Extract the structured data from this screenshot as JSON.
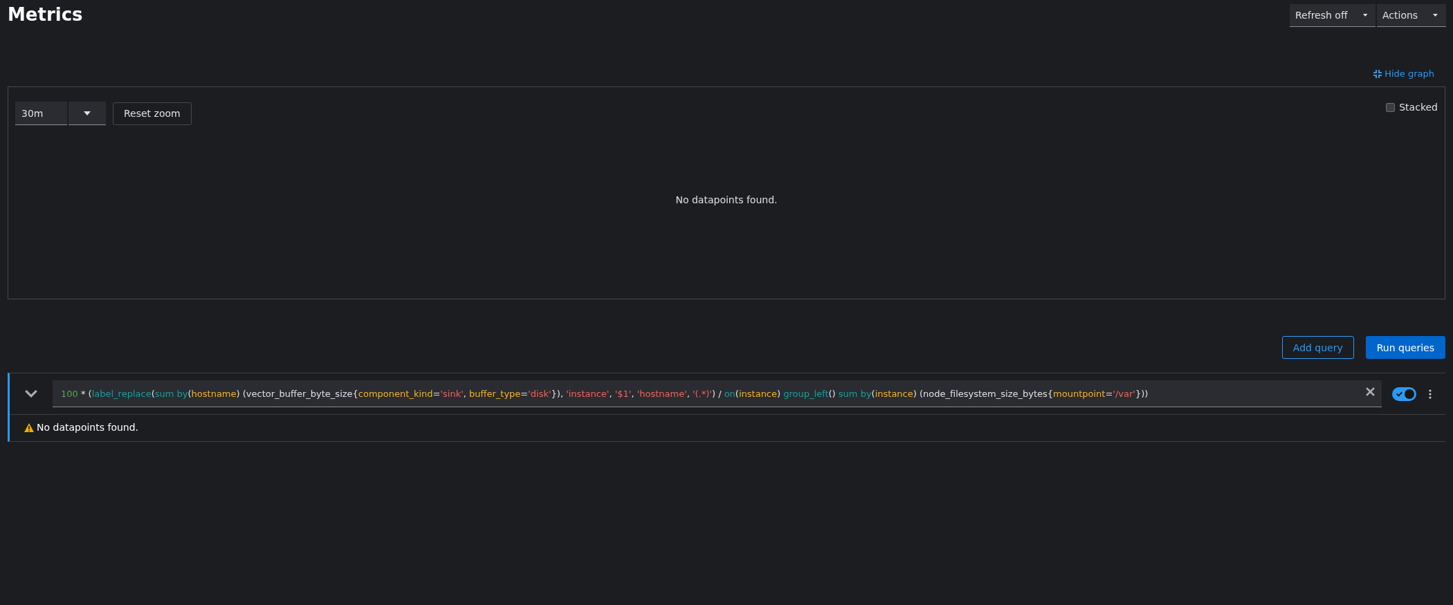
{
  "page": {
    "title": "Metrics"
  },
  "header_actions": [
    {
      "label": "Refresh off"
    },
    {
      "label": "Actions"
    }
  ],
  "graph": {
    "toggle_label": "Hide graph",
    "time_range": "30m",
    "reset_label": "Reset zoom",
    "stacked": {
      "label": "Stacked",
      "checked": false
    },
    "empty_message": "No datapoints found."
  },
  "query_actions": {
    "add_label": "Add query",
    "run_label": "Run queries"
  },
  "queries": [
    {
      "expanded": false,
      "enabled": true,
      "message": "No datapoints found.",
      "tokens": [
        {
          "kind": "number",
          "text": "100"
        },
        {
          "kind": "plain",
          "text": " * ("
        },
        {
          "kind": "func",
          "text": "label_replace"
        },
        {
          "kind": "plain",
          "text": "("
        },
        {
          "kind": "func",
          "text": "sum by"
        },
        {
          "kind": "plain",
          "text": "("
        },
        {
          "kind": "label",
          "text": "hostname"
        },
        {
          "kind": "plain",
          "text": ") (vector_buffer_byte_size{"
        },
        {
          "kind": "label",
          "text": "component_kind"
        },
        {
          "kind": "plain",
          "text": "="
        },
        {
          "kind": "string",
          "text": "'sink'"
        },
        {
          "kind": "plain",
          "text": ", "
        },
        {
          "kind": "label",
          "text": "buffer_type"
        },
        {
          "kind": "plain",
          "text": "="
        },
        {
          "kind": "string",
          "text": "'disk'"
        },
        {
          "kind": "plain",
          "text": "}), "
        },
        {
          "kind": "string",
          "text": "'instance'"
        },
        {
          "kind": "plain",
          "text": ", "
        },
        {
          "kind": "string",
          "text": "'$1'"
        },
        {
          "kind": "plain",
          "text": ", "
        },
        {
          "kind": "string",
          "text": "'hostname'"
        },
        {
          "kind": "plain",
          "text": ", "
        },
        {
          "kind": "string",
          "text": "'(.*)'"
        },
        {
          "kind": "plain",
          "text": ") / "
        },
        {
          "kind": "func",
          "text": "on"
        },
        {
          "kind": "plain",
          "text": "("
        },
        {
          "kind": "label",
          "text": "instance"
        },
        {
          "kind": "plain",
          "text": ") "
        },
        {
          "kind": "func",
          "text": "group_left"
        },
        {
          "kind": "plain",
          "text": "() "
        },
        {
          "kind": "func",
          "text": "sum by"
        },
        {
          "kind": "plain",
          "text": "("
        },
        {
          "kind": "label",
          "text": "instance"
        },
        {
          "kind": "plain",
          "text": ") (node_filesystem_size_bytes{"
        },
        {
          "kind": "label",
          "text": "mountpoint"
        },
        {
          "kind": "plain",
          "text": "="
        },
        {
          "kind": "string",
          "text": "'/var'"
        },
        {
          "kind": "plain",
          "text": "}))"
        }
      ]
    }
  ]
}
